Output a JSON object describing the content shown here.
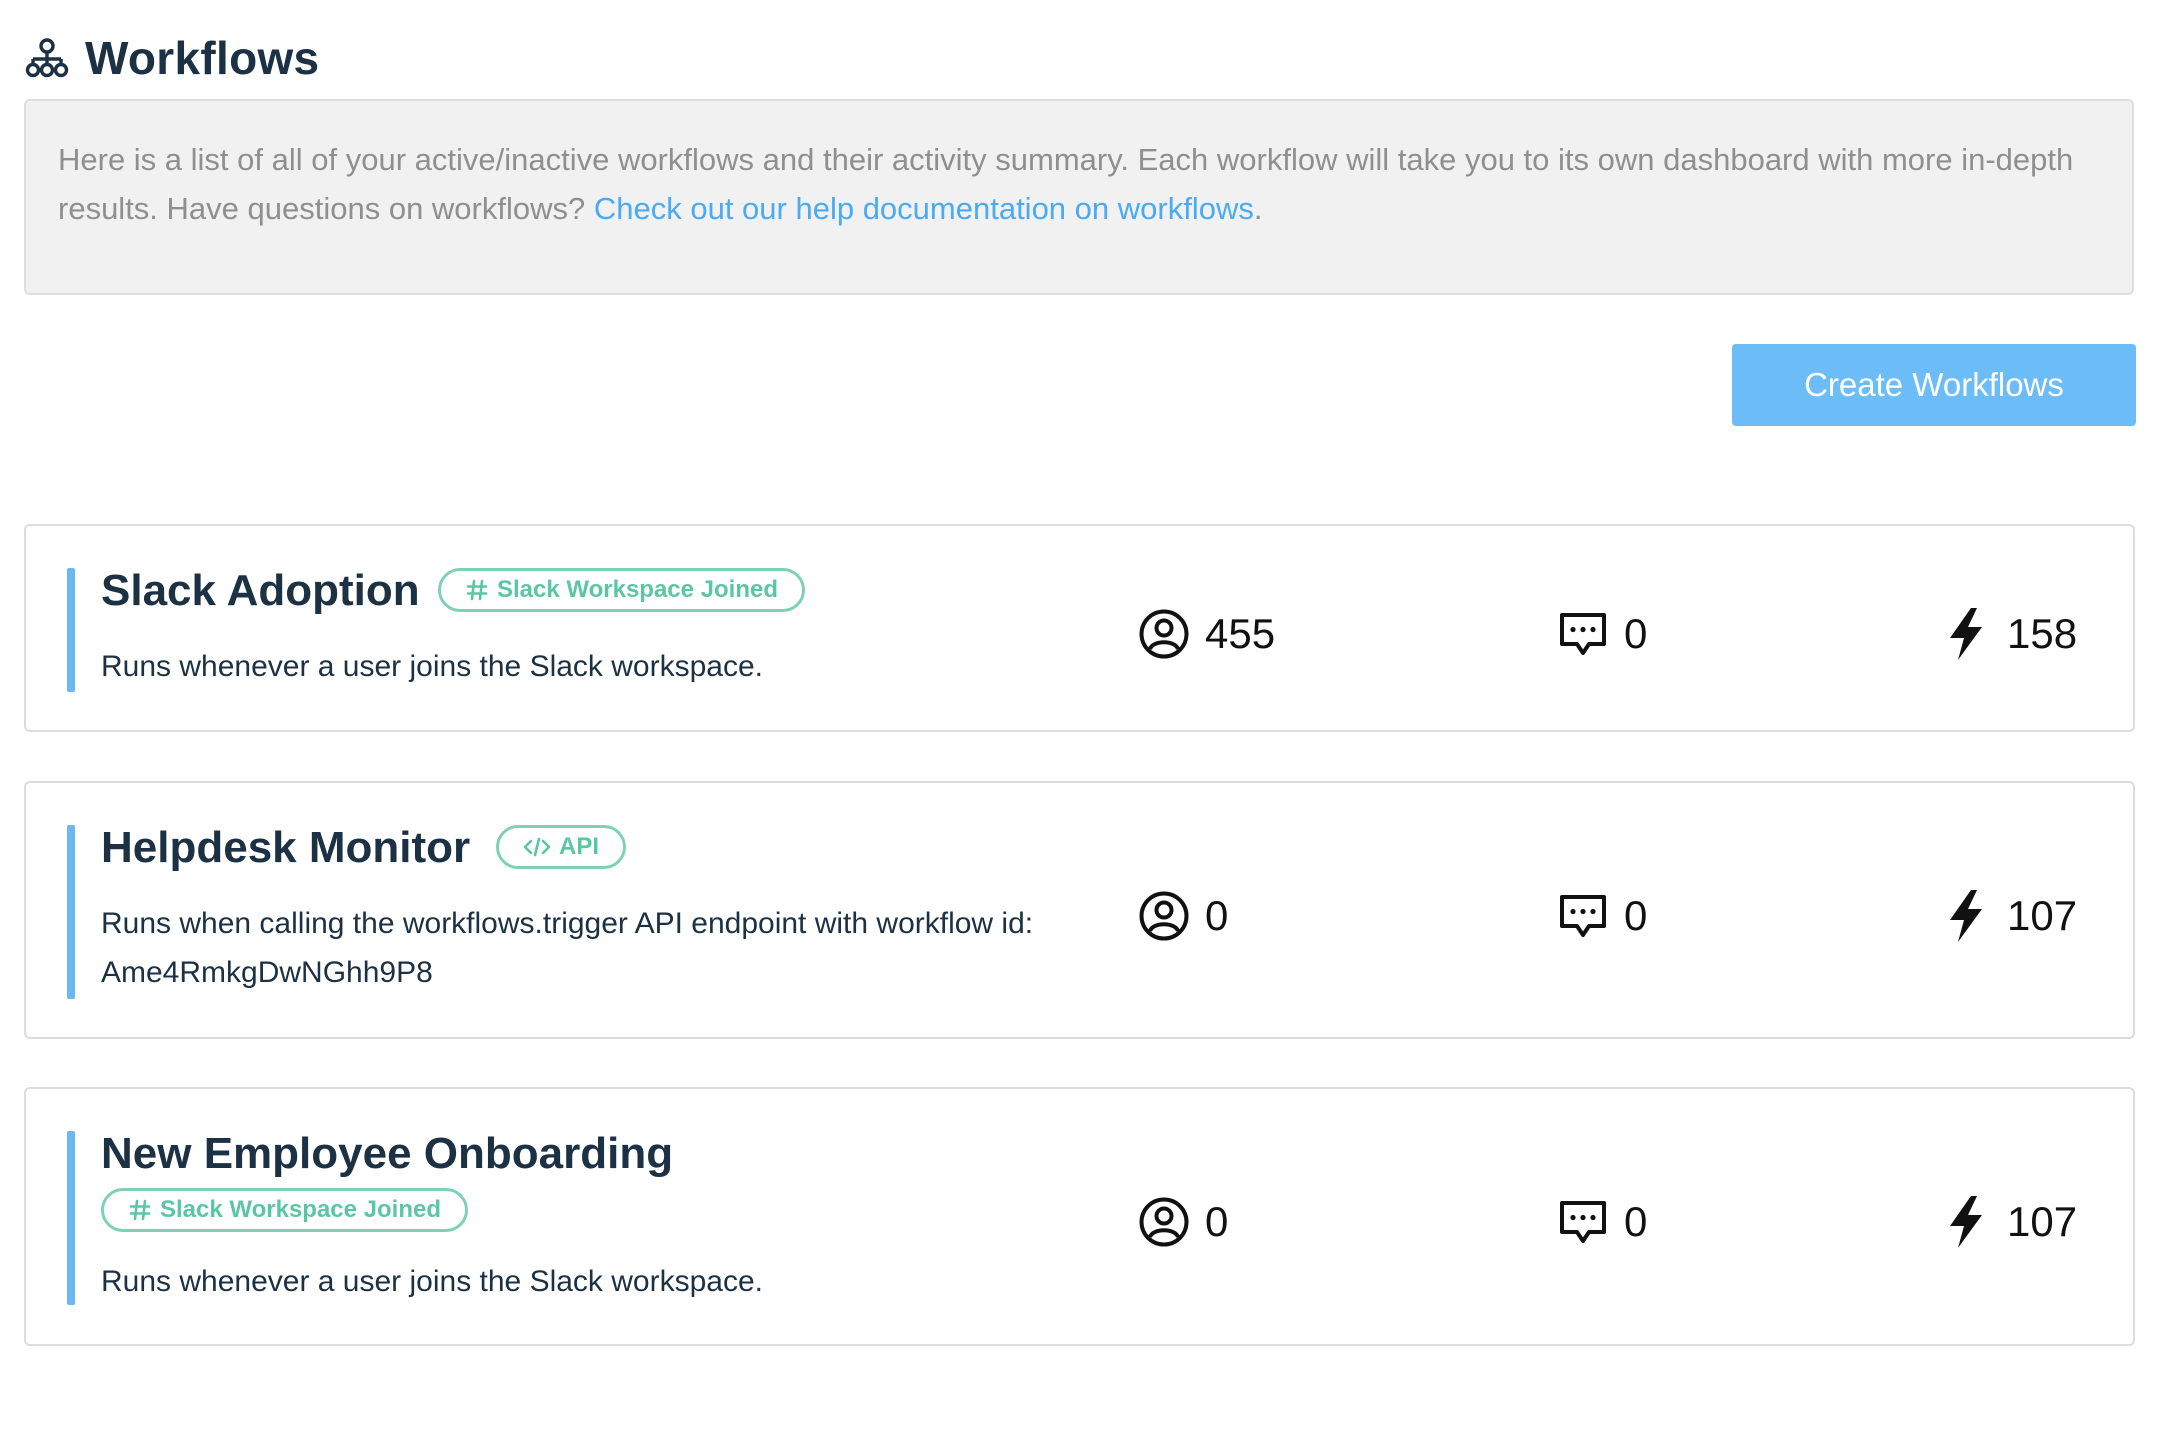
{
  "page": {
    "title": "Workflows",
    "title_icon": "workflow-tree-icon"
  },
  "intro": {
    "text": "Here is a list of all of your active/inactive workflows and their activity summary. Each workflow will take you to its own dashboard with more in-depth results. Have questions on workflows? ",
    "link_text": "Check out our help documentation on workflows",
    "trailing": "."
  },
  "actions": {
    "create_label": "Create Workflows"
  },
  "colors": {
    "accent": "#6cb8f3",
    "button": "#6cbcf7",
    "badge": "#5bc7a2",
    "link": "#4aaaf2"
  },
  "workflows": [
    {
      "name": "Slack Adoption",
      "badge": "Slack Workspace Joined",
      "badge_icon": "slack-hash-icon",
      "description": "Runs whenever a user joins the Slack workspace.",
      "users": "455",
      "messages": "0",
      "runs": "158"
    },
    {
      "name": "Helpdesk Monitor",
      "badge": "API",
      "badge_icon": "code-icon",
      "description": "Runs when calling the workflows.trigger API endpoint with workflow id: Ame4RmkgDwNGhh9P8",
      "users": "0",
      "messages": "0",
      "runs": "107"
    },
    {
      "name": "New Employee Onboarding",
      "badge": "Slack Workspace Joined",
      "badge_icon": "slack-hash-icon",
      "description": "Runs whenever a user joins the Slack workspace.",
      "users": "0",
      "messages": "0",
      "runs": "107"
    }
  ],
  "stat_icons": {
    "users": "user-circle-icon",
    "messages": "chat-bubble-icon",
    "runs": "lightning-bolt-icon"
  }
}
